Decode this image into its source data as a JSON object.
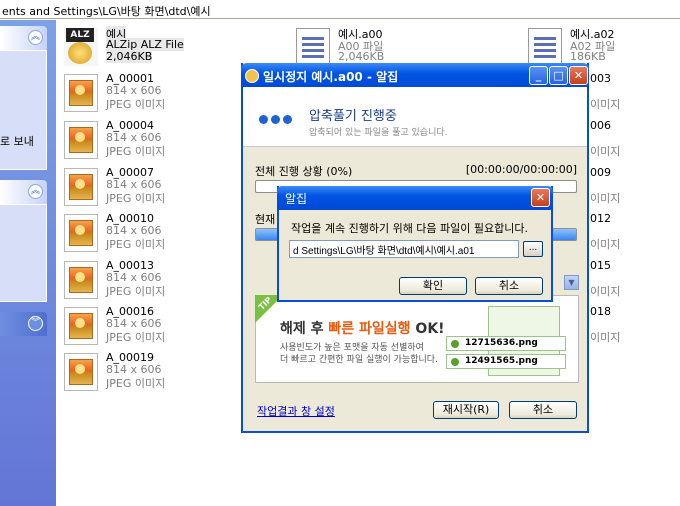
{
  "address": {
    "path": "ents and Settings\\LG\\바탕 화면\\dtd\\예시"
  },
  "left_pane": {
    "text": "로 보내"
  },
  "files": [
    {
      "name": "예시",
      "line2": "ALZip ALZ File",
      "line3": "2,046KB",
      "type": "alz"
    },
    {
      "name": "예시.a00",
      "line2": "A00 파일",
      "line3": "2,046KB",
      "type": "doc"
    },
    {
      "name": "예시.a02",
      "line2": "A02 파일",
      "line3": "186KB",
      "type": "doc"
    },
    {
      "name": "A_00001",
      "line2": "814 x 606",
      "line3": "JPEG 이미지",
      "type": "img"
    },
    {
      "name": "A_00004",
      "line2": "814 x 606",
      "line3": "JPEG 이미지",
      "type": "img"
    },
    {
      "name": "A_00007",
      "line2": "814 x 606",
      "line3": "JPEG 이미지",
      "type": "img"
    },
    {
      "name": "A_00010",
      "line2": "814 x 606",
      "line3": "JPEG 이미지",
      "type": "img"
    },
    {
      "name": "A_00013",
      "line2": "814 x 606",
      "line3": "JPEG 이미지",
      "type": "img"
    },
    {
      "name": "A_00016",
      "line2": "814 x 606",
      "line3": "JPEG 이미지",
      "type": "img"
    },
    {
      "name": "A_00019",
      "line2": "814 x 606",
      "line3": "JPEG 이미지",
      "type": "img"
    }
  ],
  "right_partial": [
    "003",
    "이미지",
    "006",
    "이미지",
    "009",
    "이미지",
    "012",
    "이미지",
    "015",
    "이미지",
    "018",
    "이미지"
  ],
  "dialog": {
    "title": "일시정지 예시.a00 - 알집",
    "header": "압축풀기 진행중",
    "subheader": "압축되어 있는 파일을 풀고 있습니다.",
    "overall_label": "전체 진행 상황 (0%)",
    "time": "[00:00:00/00:00:00]",
    "overall_progress": 0,
    "current_label": "현재",
    "current_progress": 100,
    "tip_badge": "TIP",
    "tip_title_pre": "해제 후 ",
    "tip_title_hl": "빠른 파일실행",
    "tip_title_post": " OK!",
    "tip_line1": "사용빈도가 높은 포맷을 자동 선별하여",
    "tip_line2": "더 빠르고 간편한 파일 실행이 가능합니다.",
    "tip_file1": "12715636.png",
    "tip_file2": "12491565.png",
    "link": "작업결과 창 설정",
    "restart": "재시작(R)",
    "cancel": "취소"
  },
  "subdialog": {
    "title": "알집",
    "message": "작업을 계속 진행하기 위해 다음 파일이 필요합니다.",
    "path_value": "d Settings\\LG\\바탕 화면\\dtd\\예시\\예시.a01",
    "browse": "...",
    "ok": "확인",
    "cancel": "취소"
  },
  "colors": {
    "titlebar": "#0054e3",
    "accent_orange": "#e85a0c",
    "tip_green": "#7ac143"
  }
}
